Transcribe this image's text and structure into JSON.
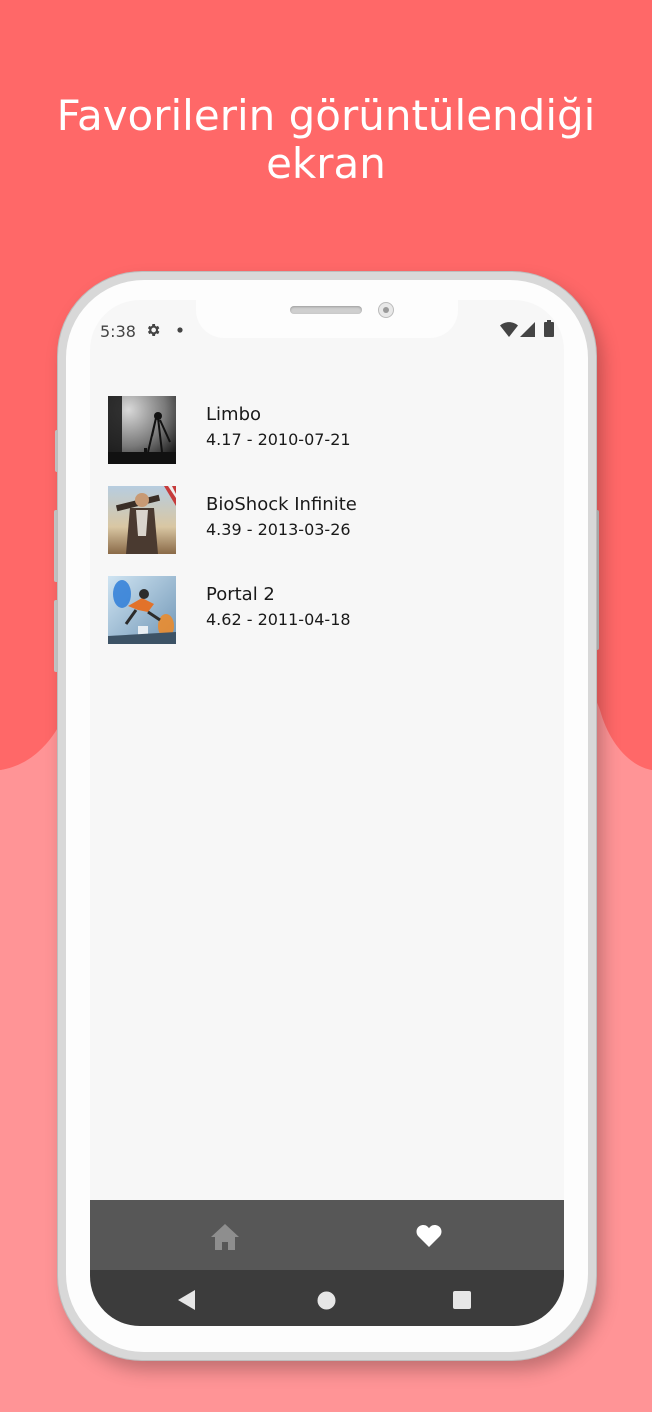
{
  "headline": {
    "line1": "Favorilerin görüntülendiği",
    "line2": "ekran"
  },
  "colors": {
    "background_top": "#ff6868",
    "background_bottom": "#ff9496",
    "screen": "#f7f7f7",
    "tab_bar": "#575757",
    "system_nav": "#3c3c3c"
  },
  "status_bar": {
    "time": "5:38",
    "icons": [
      "gear-icon",
      "dot-icon",
      "wifi-icon",
      "signal-icon",
      "battery-icon"
    ]
  },
  "favorites": [
    {
      "title": "Limbo",
      "meta": "4.17 - 2010-07-21",
      "thumb": "limbo-cover"
    },
    {
      "title": "BioShock Infinite",
      "meta": "4.39 - 2013-03-26",
      "thumb": "bioshock-cover"
    },
    {
      "title": "Portal 2",
      "meta": "4.62 - 2011-04-18",
      "thumb": "portal2-cover"
    }
  ],
  "tab_bar": {
    "tabs": [
      {
        "name": "home",
        "icon": "home-icon",
        "active": false
      },
      {
        "name": "favorites",
        "icon": "heart-icon",
        "active": true
      }
    ]
  },
  "system_nav": [
    "back-icon",
    "home-circle-icon",
    "recents-icon"
  ]
}
